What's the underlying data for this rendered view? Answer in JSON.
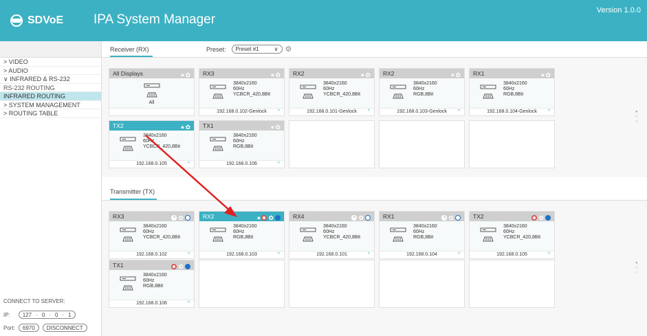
{
  "header": {
    "brand": "SDVoE",
    "app_title": "IPA System Manager",
    "version": "Version 1.0.0"
  },
  "sidebar": {
    "items": [
      {
        "label": "> VIDEO"
      },
      {
        "label": "> AUDIO"
      },
      {
        "label": "∨ INFRARED & RS-232"
      },
      {
        "label": "RS-232 ROUTING"
      },
      {
        "label": "INFRARED ROUTING"
      },
      {
        "label": "> SYSTEM MANAGEMENT"
      },
      {
        "label": "> ROUTING TABLE"
      }
    ],
    "connect_label": "CONNECT TO SERVER:",
    "ip_label": "IP:",
    "ip": [
      "127",
      "0",
      "0",
      "1"
    ],
    "port_label": "Port:",
    "port": "6970",
    "disconnect": "DISCONNECT"
  },
  "receiver": {
    "tab": "Receiver (RX)",
    "preset_label": "Preset:",
    "preset_value": "Preset #1",
    "cards": [
      {
        "title": "All Displays",
        "l1": "",
        "l2": "",
        "l3": "",
        "footer": "",
        "all": "All"
      },
      {
        "title": "RX3",
        "l1": "3840x2160",
        "l2": "60Hz",
        "l3": "YCBCR_420,8Bit",
        "footer": "192.168.0.102-Genlock"
      },
      {
        "title": "RX2",
        "l1": "3840x2160",
        "l2": "60Hz",
        "l3": "YCBCR_420,8Bit",
        "footer": "192.168.0.101-Genlock"
      },
      {
        "title": "RX2",
        "l1": "3840x2160",
        "l2": "60Hz",
        "l3": "RGB,8Bit",
        "footer": "192.168.0.103-Genlock"
      },
      {
        "title": "RX1",
        "l1": "3840x2160",
        "l2": "60Hz",
        "l3": "RGB,8Bit",
        "footer": "192.168.0.104-Genlock"
      },
      {
        "title": "TX2",
        "l1": "3840x2160",
        "l2": "60Hz",
        "l3": "YCBCR_420,8Bit",
        "footer": "192.168.0.105"
      },
      {
        "title": "TX1",
        "l1": "3840x2160",
        "l2": "60Hz",
        "l3": "RGB,8Bit",
        "footer": "192.168.0.106"
      }
    ]
  },
  "transmitter": {
    "tab": "Transmitter (TX)",
    "cards": [
      {
        "title": "RX3",
        "l1": "3840x2160",
        "l2": "60Hz",
        "l3": "YCBCR_420,8Bit",
        "footer": "192.168.0.102"
      },
      {
        "title": "RX2",
        "l1": "3840x2160",
        "l2": "60Hz",
        "l3": "RGB,8Bit",
        "footer": "192.168.0.103"
      },
      {
        "title": "RX4",
        "l1": "3840x2160",
        "l2": "60Hz",
        "l3": "YCBCR_420,8Bit",
        "footer": "192.168.0.101"
      },
      {
        "title": "RX1",
        "l1": "3840x2160",
        "l2": "60Hz",
        "l3": "RGB,8Bit",
        "footer": "192.168.0.104"
      },
      {
        "title": "TX2",
        "l1": "3840x2160",
        "l2": "60Hz",
        "l3": "YCBCR_420,8Bit",
        "footer": "192.168.0.105"
      },
      {
        "title": "TX1",
        "l1": "3840x2160",
        "l2": "60Hz",
        "l3": "RGB,8Bit",
        "footer": "192.168.0.106"
      }
    ]
  },
  "colors": {
    "accent": "#3cb1c3",
    "arrow": "#e02020",
    "status_red": "#d9534f",
    "status_blue": "#1a73c9"
  }
}
